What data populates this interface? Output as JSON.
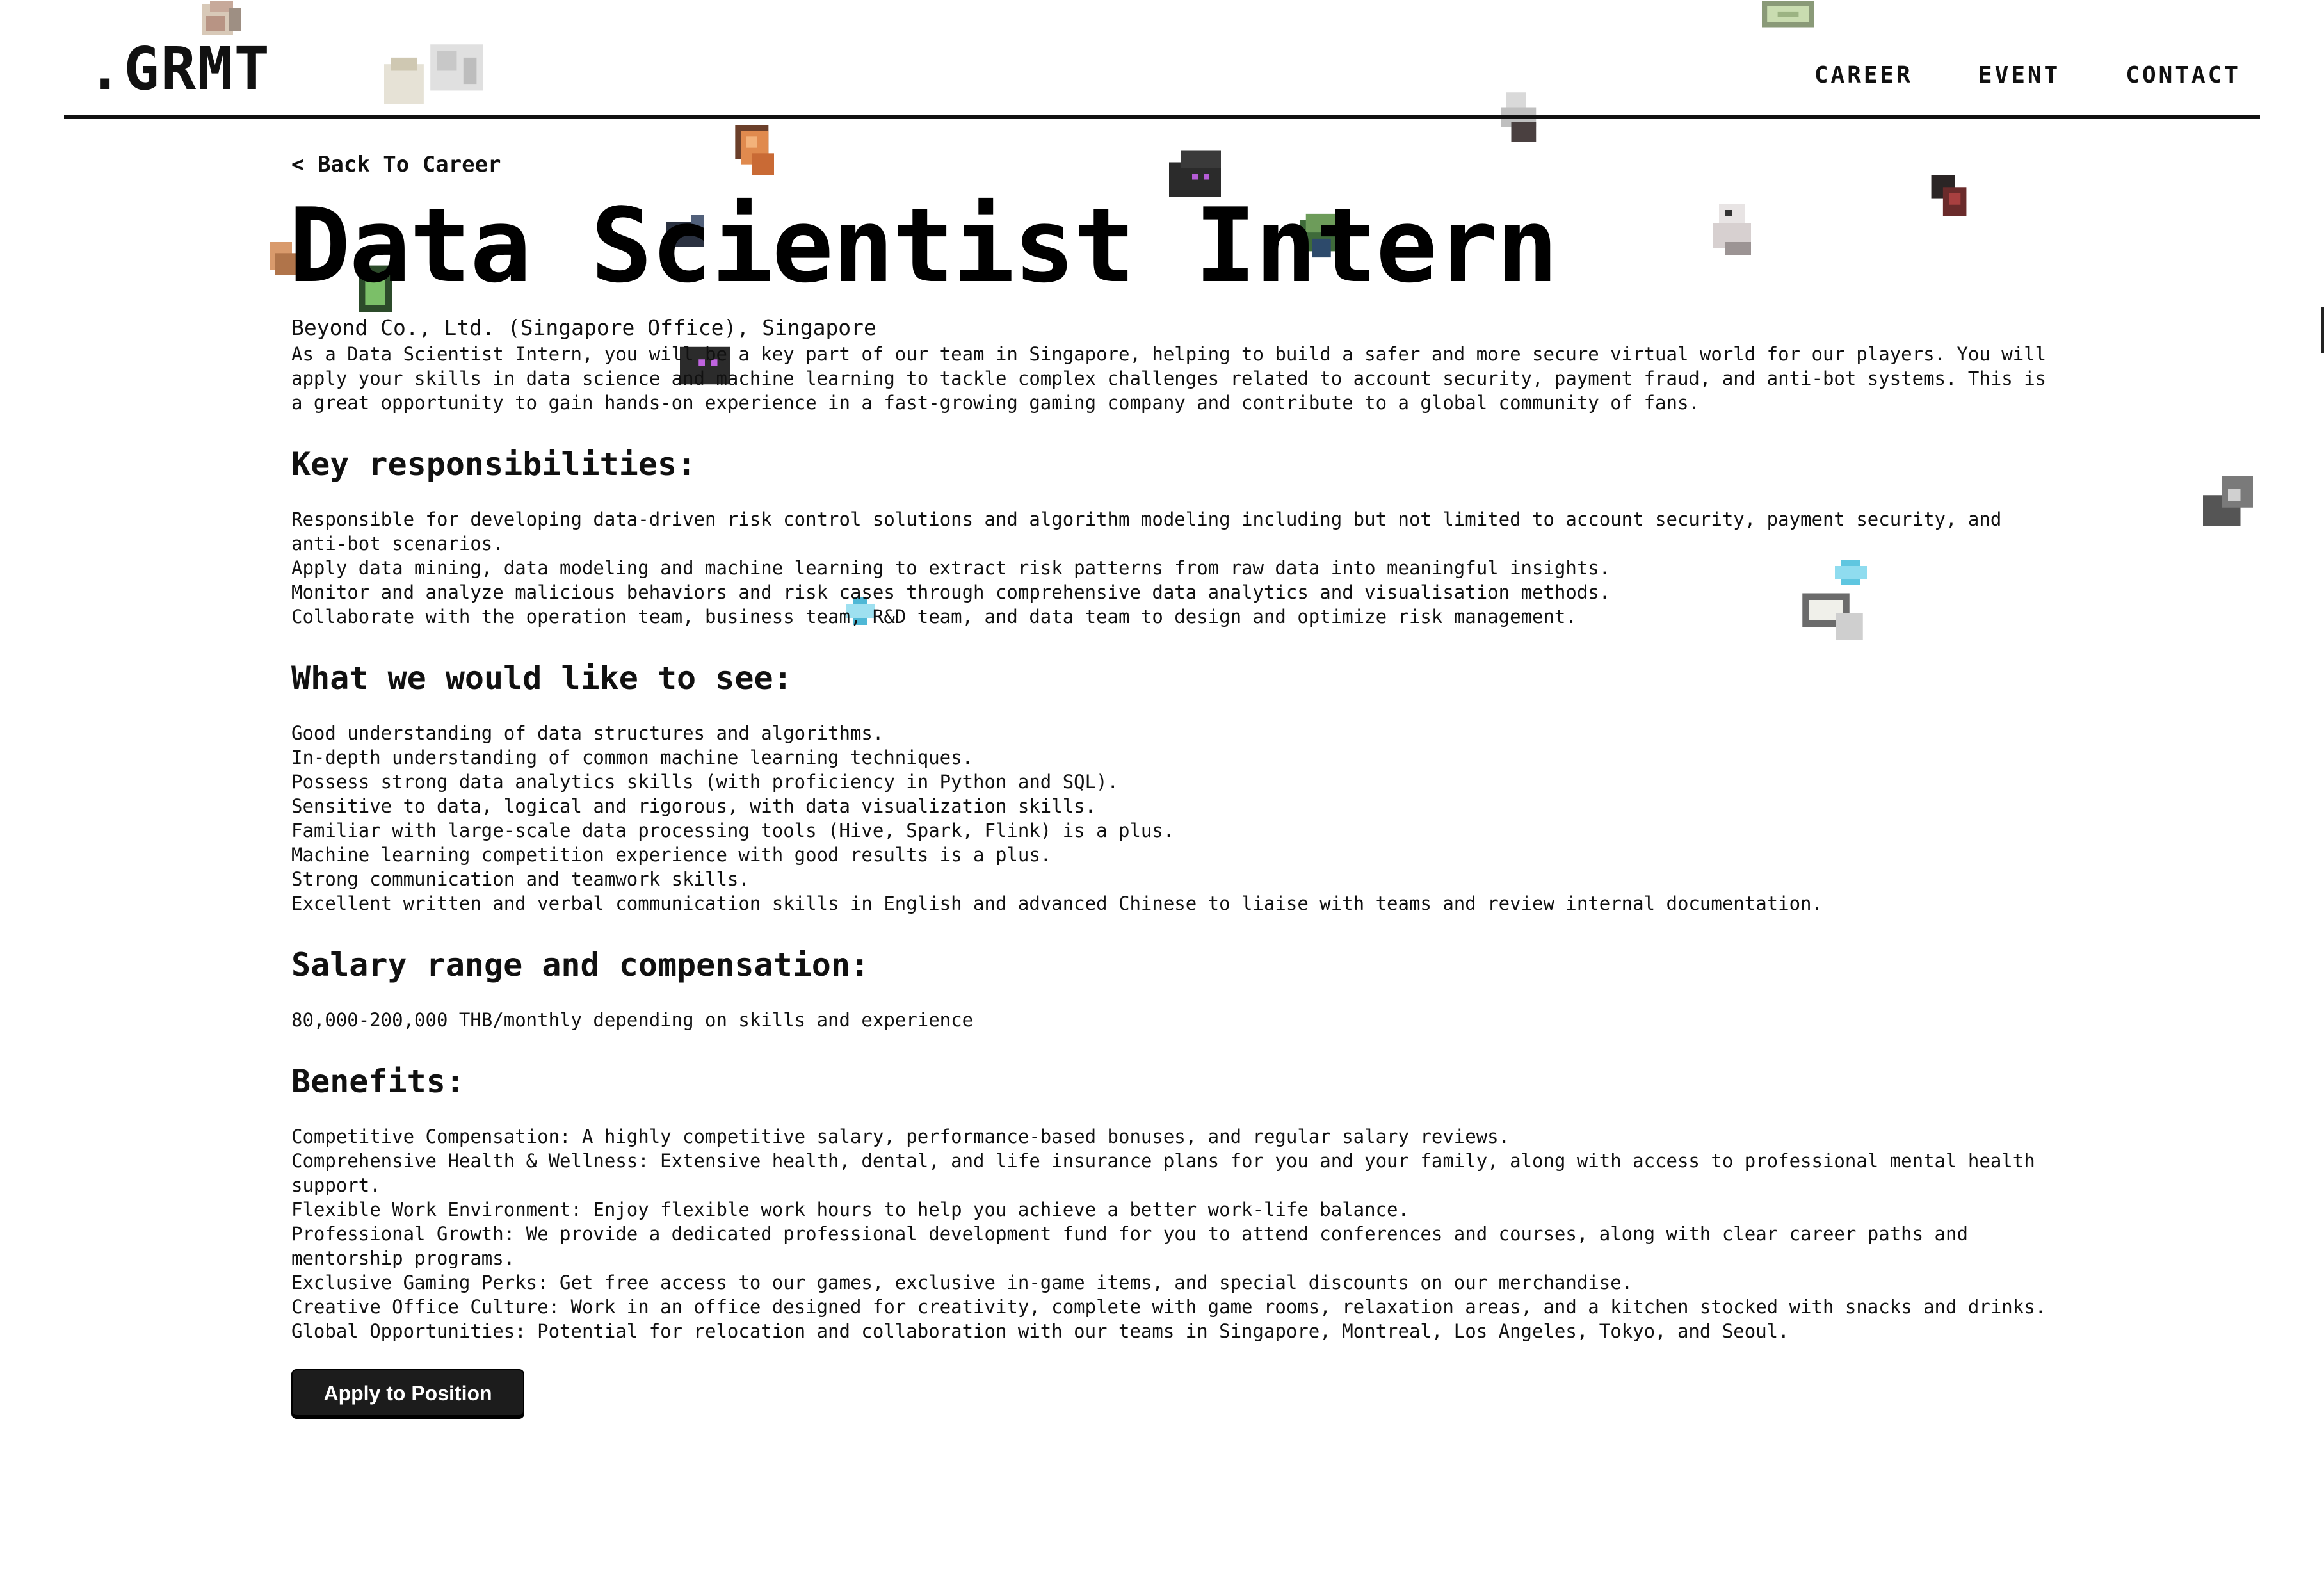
{
  "header": {
    "logo": ".GRMT",
    "nav": [
      "CAREER",
      "EVENT",
      "CONTACT"
    ]
  },
  "job": {
    "back_label": "< Back To Career",
    "title": "Data Scientist Intern",
    "company": "Beyond Co., Ltd. (Singapore Office), Singapore",
    "intro": "As a Data Scientist Intern, you will be a key part of our team in Singapore, helping to build a safer and more secure virtual world for our players. You will apply your skills in data science and machine learning to tackle complex challenges related to account security, payment fraud, and anti-bot systems. This is a great opportunity to gain hands-on experience in a fast-growing gaming company and contribute to a global community of fans."
  },
  "responsibilities": {
    "heading": "Key responsibilities:",
    "items": [
      "Responsible for developing data-driven risk control solutions and algorithm modeling including but not limited to account security, payment security, and anti-bot scenarios.",
      "Apply data mining, data modeling and machine learning to extract risk patterns from raw data into meaningful insights.",
      "Monitor and analyze malicious behaviors and risk cases through comprehensive data analytics and visualisation methods.",
      "Collaborate with the operation team, business team, R&D team, and data team to design and optimize risk management."
    ]
  },
  "requirements": {
    "heading": "What we would like to see:",
    "items": [
      "Good understanding of data structures and algorithms.",
      "In-depth understanding of common machine learning techniques.",
      "Possess strong data analytics skills (with proficiency in Python and SQL).",
      "Sensitive to data, logical and rigorous, with data visualization skills.",
      "Familiar with large-scale data processing tools (Hive, Spark, Flink) is a plus.",
      "Machine learning competition experience with good results is a plus.",
      "Strong communication and teamwork skills.",
      "Excellent written and verbal communication skills in English and advanced Chinese to liaise with teams and review internal documentation."
    ]
  },
  "salary": {
    "heading": "Salary range and compensation:",
    "text": "80,000-200,000 THB/monthly depending on skills and experience"
  },
  "benefits": {
    "heading": "Benefits:",
    "items": [
      "Competitive Compensation: A highly competitive salary, performance-based bonuses, and regular salary reviews.",
      "Comprehensive Health & Wellness: Extensive health, dental, and life insurance plans for you and your family, along with access to professional mental health support.",
      "Flexible Work Environment: Enjoy flexible work hours to help you achieve a better work-life balance.",
      "Professional Growth: We provide a dedicated professional development fund for you to attend conferences and courses, along with clear career paths and mentorship programs.",
      "Exclusive Gaming Perks: Get free access to our games, exclusive in-game items, and special discounts on our merchandise.",
      "Creative Office Culture: Work in an office designed for creativity, complete with game rooms, relaxation areas, and a kitchen stocked with snacks and drinks.",
      "Global Opportunities: Potential for relocation and collaboration with our teams in Singapore, Montreal, Los Angeles, Tokyo, and Seoul."
    ]
  },
  "cta": {
    "apply_label": "Apply to Position"
  },
  "colors": {
    "text": "#111111",
    "background": "#ffffff",
    "button": "#1c1c1c"
  },
  "decorations": [
    "pixel-sprite-icon-beige",
    "pixel-sprite-icon-grey",
    "pixel-sprite-icon-green-card",
    "pixel-sprite-icon-orange",
    "pixel-sprite-icon-purple-dark",
    "pixel-sprite-icon-dark",
    "pixel-sprite-icon-skull",
    "pixel-sprite-icon-red-dark",
    "pixel-sprite-icon-green-tube",
    "pixel-sprite-icon-cyan",
    "pixel-sprite-icon-white"
  ]
}
